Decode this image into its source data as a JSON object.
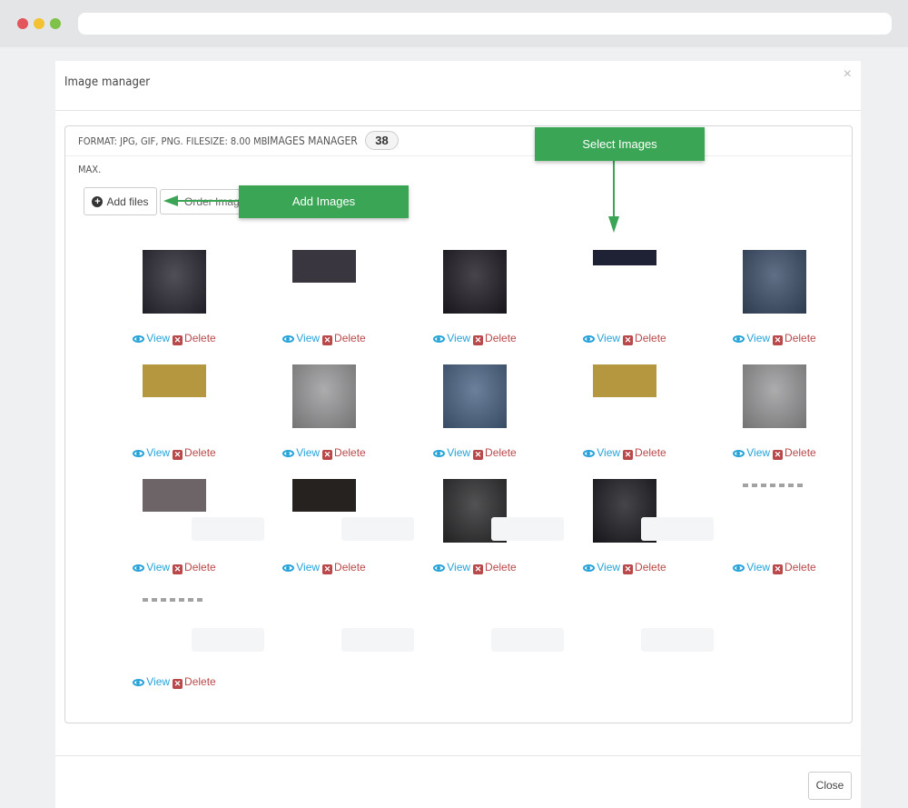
{
  "browser": {
    "url": ""
  },
  "modal": {
    "title": "Image manager",
    "close_glyph": "×",
    "format_text": "FORMAT: JPG, GIF, PNG. FILESIZE: 8.00 MB",
    "manager_label": "IMAGES MANAGER",
    "image_count": "38",
    "max_label": "MAX.",
    "add_files_label": "Add files",
    "order_label": "Order Image By",
    "view_label": "View",
    "delete_label": "Delete",
    "close_button": "Close"
  },
  "callouts": {
    "add_images": "Add Images",
    "select_images": "Select Images"
  },
  "colors": {
    "accent_green": "#3aa655",
    "view_blue": "#25a3d9",
    "delete_red": "#b9484a"
  },
  "images": [
    {
      "id": 1,
      "shape": "square",
      "fill": "#2a2833",
      "subject": "man-portrait"
    },
    {
      "id": 2,
      "shape": "wide",
      "fill": "#3a3640",
      "subject": "hands"
    },
    {
      "id": 3,
      "shape": "square",
      "fill": "#1f1b24",
      "subject": "woman-back"
    },
    {
      "id": 4,
      "shape": "thin",
      "fill": "#1f2135",
      "subject": "dark-banner"
    },
    {
      "id": 5,
      "shape": "square",
      "fill": "#3d4f6a",
      "subject": "bearded-man"
    },
    {
      "id": 6,
      "shape": "wide",
      "fill": "#b59740",
      "subject": "gold-banner"
    },
    {
      "id": 7,
      "shape": "square",
      "fill": "#9a9a9c",
      "subject": "dancer"
    },
    {
      "id": 8,
      "shape": "square",
      "fill": "#4b6485",
      "subject": "bearded-man-2"
    },
    {
      "id": 9,
      "shape": "wide",
      "fill": "#b59740",
      "subject": "gold-banner-2"
    },
    {
      "id": 10,
      "shape": "square",
      "fill": "#9a9a9c",
      "subject": "dancer-2"
    },
    {
      "id": 11,
      "shape": "wide",
      "fill": "#6d6468",
      "subject": "street"
    },
    {
      "id": 12,
      "shape": "wide",
      "fill": "#25221f",
      "subject": "collar"
    },
    {
      "id": 13,
      "shape": "square",
      "fill": "#2c2c2e",
      "subject": "motorbike"
    },
    {
      "id": 14,
      "shape": "square",
      "fill": "#1d1d22",
      "subject": "woman-dark"
    },
    {
      "id": 15,
      "shape": "payment",
      "fill": "#ffffff",
      "subject": "payment-logos"
    },
    {
      "id": 16,
      "shape": "payment",
      "fill": "#ffffff",
      "subject": "payment-logos-2"
    }
  ]
}
